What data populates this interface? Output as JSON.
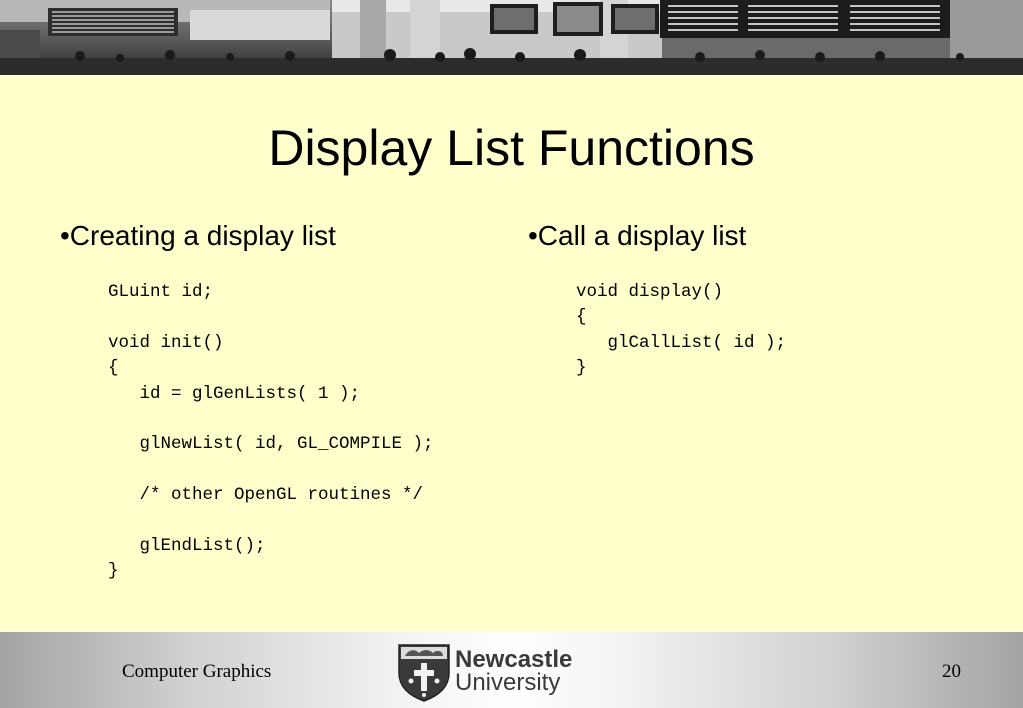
{
  "slide": {
    "title": "Display List Functions",
    "left": {
      "bullet": "•Creating a display list",
      "code": "GLuint id;\n\nvoid init()\n{\n   id = glGenLists( 1 );\n\n   glNewList( id, GL_COMPILE );\n\n   /* other OpenGL routines */\n\n   glEndList();\n}"
    },
    "right": {
      "bullet": "•Call a display list",
      "code": "void display()\n{\n   glCallList( id );\n}"
    }
  },
  "footer": {
    "course": "Computer Graphics",
    "page_number": "20",
    "logo_line1": "Newcastle",
    "logo_line2": "University"
  },
  "colors": {
    "slide_background": "#ffffcc",
    "text": "#000000",
    "logo_text": "#3a3a3a"
  },
  "banner": {
    "icon": "airport-terminal-photo"
  }
}
